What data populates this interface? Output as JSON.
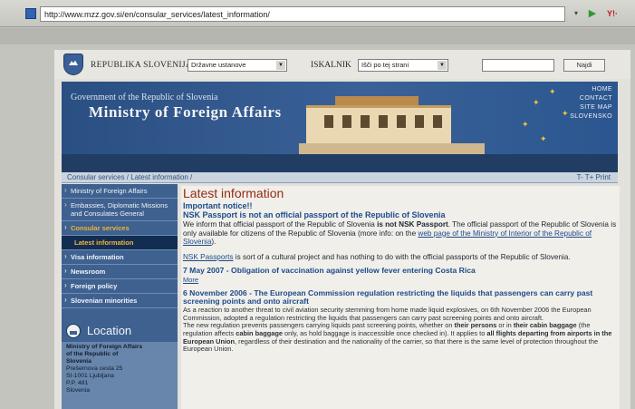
{
  "browser": {
    "url": "http://www.mzz.gov.si/en/consular_services/latest_information/",
    "address_dropdown": "▾",
    "go": "▶",
    "extension": "Y!·"
  },
  "topbar": {
    "republic": "REPUBLIKA SLOVENIJA",
    "select1": "Državne ustanove",
    "iskalnik": "ISKALNIK",
    "select2": "Išči po tej strani",
    "search_button": "Najdi"
  },
  "banner": {
    "subtitle": "Government of the Republic of Slovenia",
    "title": "Ministry of Foreign Affairs",
    "nav": [
      "HOME",
      "CONTACT",
      "SITE MAP",
      "SLOVENSKO"
    ]
  },
  "breadcrumb": {
    "path": "Consular services  /  Latest information  /",
    "tools": "T-  T+ Print"
  },
  "sidebar": {
    "items": [
      {
        "label": "Ministry of Foreign Affairs",
        "style": "plain"
      },
      {
        "label": "Embassies, Diplomatic Missions and Consulates General",
        "style": "plain"
      },
      {
        "label": "Consular services",
        "style": "orange"
      },
      {
        "label": "Latest information",
        "style": "active"
      },
      {
        "label": "Visa information",
        "style": "bold"
      },
      {
        "label": "Newsroom",
        "style": "bold"
      },
      {
        "label": "Foreign policy",
        "style": "bold"
      },
      {
        "label": "Slovenian minorities",
        "style": "bold"
      }
    ],
    "location_title": "Location",
    "location_lines": [
      "Ministry of Foreign Affairs",
      "of the Republic of",
      "Slovenia",
      "Prešernova cesta 25",
      "SI-1001 Ljubljana",
      "P.P. 481",
      "Slovenia"
    ]
  },
  "content": {
    "title": "Latest information",
    "notice_label": "Important notice!!",
    "notice_headline": "NSK Passport is not an official passport of the Republic of Slovenia",
    "p1_a": "We inform that official passport of the Republic of Slovenia ",
    "p1_bold": "is not NSK Passport",
    "p1_b": ". The official passport of the Republic of Slovenia is only available for citizens of the Republic of Slovenia (more info: on the ",
    "p1_link": "web page of the Ministry of Interior of the Republic of Slovenia",
    "p1_c": ").",
    "p2_link": "NSK Passports",
    "p2_text": " is sort of a cultural project and has nothing to do with the official passports of the Republic of Slovenia.",
    "item2_headline": "7 May 2007 - Obligation of vaccination against yellow fever entering Costa Rica",
    "more_label": "More",
    "item3_headline": "6 November 2006 - The European Commission regulation restricting the liquids that passengers can carry past screening points and onto aircraft",
    "item3_p1": "As a reaction to another threat to civil aviation security stemming from home made liquid explosives, on 6th November 2006 the European Commission, adopted a regulation restricting the liquids that passengers can carry past screening points and onto aircraft.",
    "item3_p2_a": "The new regulation prevents passengers carrying liquids past screening points, whether on ",
    "item3_p2_b1": "their persons",
    "item3_p2_c": " or in ",
    "item3_p2_b2": "their cabin baggage",
    "item3_p2_d": " (the regulation affects ",
    "item3_p2_b3": "cabin baggage",
    "item3_p2_e": " only, as hold baggage is inaccessible once checked in). It applies to ",
    "item3_p2_b4": "all flights departing from airports in the European Union",
    "item3_p2_f": ", regardless of their destination and the nationality of the carrier, so that there is the same level of protection throughout the European Union."
  }
}
